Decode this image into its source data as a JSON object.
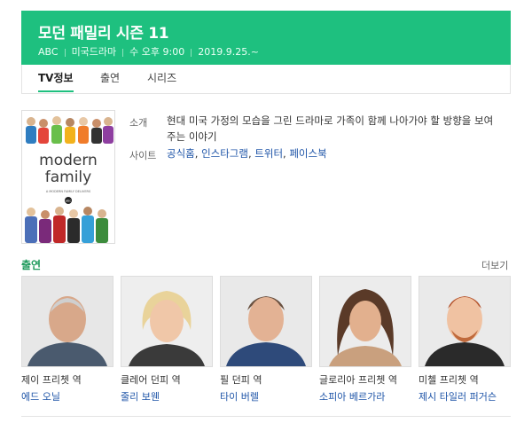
{
  "header": {
    "title": "모던 패밀리 시즌 11",
    "network": "ABC",
    "genre": "미국드라마",
    "schedule": "수 오후 9:00",
    "premiere": "2019.9.25.~",
    "bg_color": "#1ec07f"
  },
  "tabs": [
    {
      "label": "TV정보",
      "active": true
    },
    {
      "label": "출연",
      "active": false
    },
    {
      "label": "시리즈",
      "active": false
    }
  ],
  "poster": {
    "title_line1": "modern",
    "title_line2": "family",
    "tagline": "A MODERN FAMILY DELIVERS",
    "network_logo": "abc"
  },
  "info": {
    "intro_label": "소개",
    "intro_text": "현대 미국 가정의 모습을 그린 드라마로 가족이 함께 나아가야 할 방향을 보여주는 이야기",
    "site_label": "사이트",
    "sites": [
      "공식홈",
      "인스타그램",
      "트위터",
      "페이스북"
    ]
  },
  "cast": {
    "heading": "출연",
    "more_label": "더보기",
    "members": [
      {
        "role": "제이 프리쳇 역",
        "actor": "에드 오닐"
      },
      {
        "role": "클레어 던피 역",
        "actor": "줄리 보웬"
      },
      {
        "role": "필 던피 역",
        "actor": "타이 버렐"
      },
      {
        "role": "글로리아 프리쳇 역",
        "actor": "소피아 베르가라"
      },
      {
        "role": "미첼 프리쳇 역",
        "actor": "제시 타일러 퍼거슨"
      }
    ]
  }
}
